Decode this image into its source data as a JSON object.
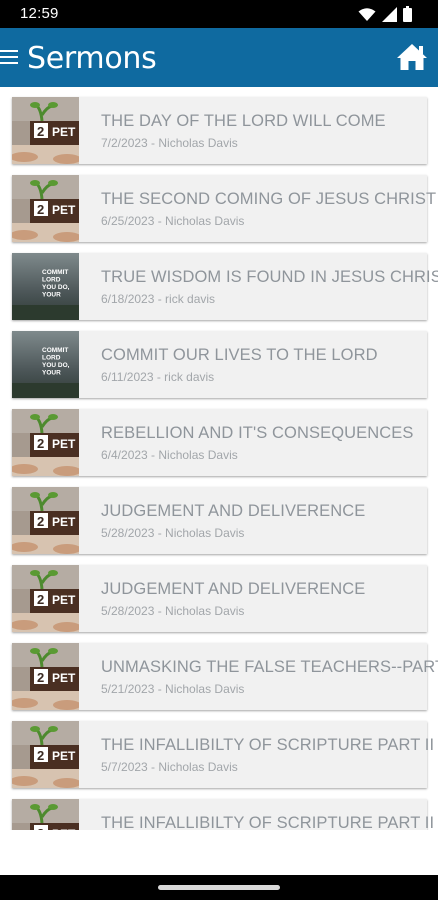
{
  "status": {
    "time": "12:59"
  },
  "header": {
    "title": "Sermons"
  },
  "colors": {
    "app_bar": "#0f6aa0",
    "card_bg": "#f1f1f1",
    "title_text": "#8f959b"
  },
  "sermons": [
    {
      "title": "THE DAY OF THE LORD WILL COME",
      "meta": "7/2/2023 - Nicholas Davis",
      "thumb": "peter-series-icon"
    },
    {
      "title": "THE SECOND COMING OF JESUS CHRIST",
      "meta": "6/25/2023 - Nicholas Davis",
      "thumb": "peter-series-icon"
    },
    {
      "title": "TRUE WISDOM IS FOUND IN JESUS CHRIST",
      "meta": "6/18/2023 - rick davis",
      "thumb": "commit-series-icon",
      "thumb_text": [
        "COMMIT",
        "LORD",
        "YOU DO,",
        "YOUR"
      ]
    },
    {
      "title": "COMMIT OUR LIVES TO THE LORD",
      "meta": "6/11/2023 - rick davis",
      "thumb": "commit-series-icon",
      "thumb_text": [
        "COMMIT",
        "LORD",
        "YOU DO,",
        "YOUR"
      ]
    },
    {
      "title": "REBELLION AND IT'S CONSEQUENCES",
      "meta": "6/4/2023 - Nicholas Davis",
      "thumb": "peter-series-icon"
    },
    {
      "title": "JUDGEMENT AND DELIVERENCE",
      "meta": "5/28/2023 - Nicholas Davis",
      "thumb": "peter-series-icon"
    },
    {
      "title": "JUDGEMENT AND DELIVERENCE",
      "meta": "5/28/2023 - Nicholas Davis",
      "thumb": "peter-series-icon"
    },
    {
      "title": "UNMASKING THE FALSE TEACHERS--PART II",
      "meta": "5/21/2023 - Nicholas Davis",
      "thumb": "peter-series-icon"
    },
    {
      "title": "THE INFALLIBILTY OF SCRIPTURE PART II",
      "meta": "5/7/2023 - Nicholas Davis",
      "thumb": "peter-series-icon"
    },
    {
      "title": "THE INFALLIBILTY OF SCRIPTURE PART II",
      "meta": "",
      "thumb": "peter-series-icon"
    }
  ],
  "peter_thumb_text": {
    "number": "2",
    "letters": "PET"
  }
}
